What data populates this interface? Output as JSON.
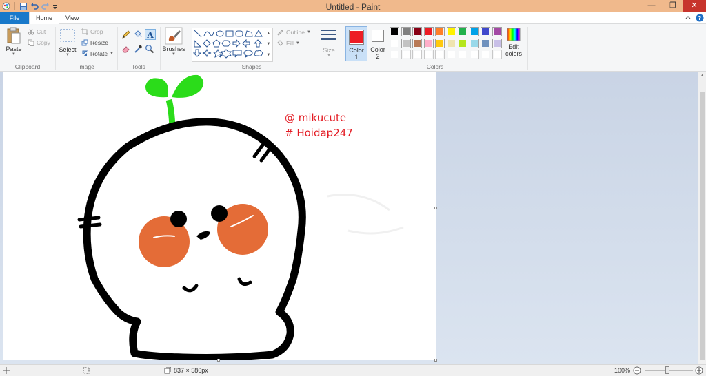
{
  "window": {
    "title": "Untitled - Paint"
  },
  "tabs": {
    "file": "File",
    "home": "Home",
    "view": "View"
  },
  "ribbon": {
    "clipboard": {
      "label": "Clipboard",
      "paste": "Paste",
      "cut": "Cut",
      "copy": "Copy"
    },
    "image": {
      "label": "Image",
      "select": "Select",
      "crop": "Crop",
      "resize": "Resize",
      "rotate": "Rotate"
    },
    "tools": {
      "label": "Tools"
    },
    "brushes": {
      "label": "Brushes"
    },
    "shapes": {
      "label": "Shapes",
      "outline": "Outline",
      "fill": "Fill"
    },
    "size": {
      "label": "Size"
    },
    "color1": {
      "label_line1": "Color",
      "label_line2": "1",
      "value": "#ed1c24"
    },
    "color2": {
      "label_line1": "Color",
      "label_line2": "2",
      "value": "#ffffff"
    },
    "colors": {
      "label": "Colors",
      "edit_line1": "Edit",
      "edit_line2": "colors",
      "row1": [
        "#000000",
        "#7f7f7f",
        "#880015",
        "#ed1c24",
        "#ff7f27",
        "#fff200",
        "#22b14c",
        "#00a2e8",
        "#3f48cc",
        "#a349a4"
      ],
      "row2": [
        "#ffffff",
        "#c3c3c3",
        "#b97a57",
        "#ffaec9",
        "#ffc90e",
        "#efe4b0",
        "#b5e61d",
        "#99d9ea",
        "#7092be",
        "#c8bfe7"
      ],
      "row3": [
        "#ffffff",
        "#ffffff",
        "#ffffff",
        "#ffffff",
        "#ffffff",
        "#ffffff",
        "#ffffff",
        "#ffffff",
        "#ffffff",
        "#ffffff"
      ]
    }
  },
  "canvas": {
    "text_line1": "@ mikucute",
    "text_line2": "# Hoidap247",
    "text_color": "#e31b23",
    "stroke_color": "#000000",
    "sprout_color": "#2bdc1a",
    "blush_color": "#e46c37"
  },
  "status": {
    "size": "837 × 586px",
    "zoom": "100%"
  }
}
